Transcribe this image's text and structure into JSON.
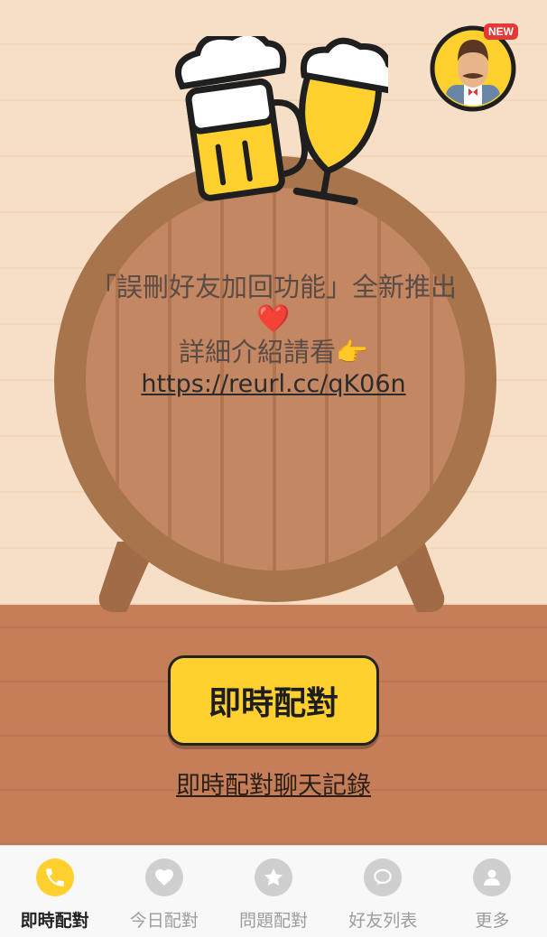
{
  "notice": {
    "line1": "「誤刪好友加回功能」全新推出",
    "heart": "❤️",
    "line2": "詳細介紹請看👉",
    "url": "https://reurl.cc/qK06n"
  },
  "avatar": {
    "badge": "NEW"
  },
  "primary_button": {
    "label": "即時配對"
  },
  "history_link": {
    "label": "即時配對聊天記錄"
  },
  "tabs": [
    {
      "label": "即時配對",
      "icon": "phone-icon",
      "active": true
    },
    {
      "label": "今日配對",
      "icon": "heart-icon",
      "active": false
    },
    {
      "label": "問題配對",
      "icon": "star-icon",
      "active": false
    },
    {
      "label": "好友列表",
      "icon": "chat-bubbles-icon",
      "active": false
    },
    {
      "label": "更多",
      "icon": "person-icon",
      "active": false
    }
  ],
  "colors": {
    "accent": "#ffd02e",
    "wall": "#f7dec6",
    "floor": "#c57e58",
    "barrel": "#a8744b"
  }
}
